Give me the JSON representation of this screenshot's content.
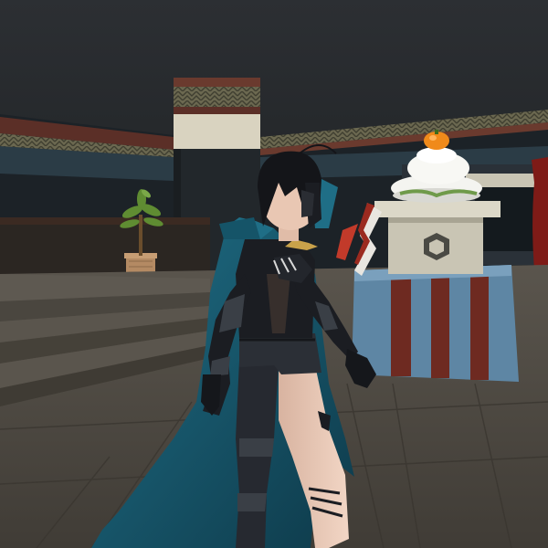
{
  "scene": {
    "description_visible_text": "",
    "palette": {
      "ceiling": "#2a2d31",
      "wall_dark": "#1e2a30",
      "trim_cream": "#d8d2bf",
      "trim_pattern": "#5b5a46",
      "trim_red": "#6a3a2e",
      "floor": "#4f4a43",
      "floor_line": "#3a3630",
      "cloak_teal": "#1a5e73",
      "cloak_shadow": "#0f3c4c",
      "outfit_black": "#1b1d22",
      "armor_gray": "#3a3f46",
      "skin": "#e9c7b3",
      "hair": "#141519",
      "altar_blue": "#5e86a4",
      "altar_red": "#6e2a21",
      "stone": "#c9c5b4",
      "rice_cake": "#f4f4f0",
      "orange": "#f08a1a",
      "plant_green": "#5f8c32",
      "pot": "#b48a63",
      "curtain_red": "#7e1b17"
    }
  }
}
